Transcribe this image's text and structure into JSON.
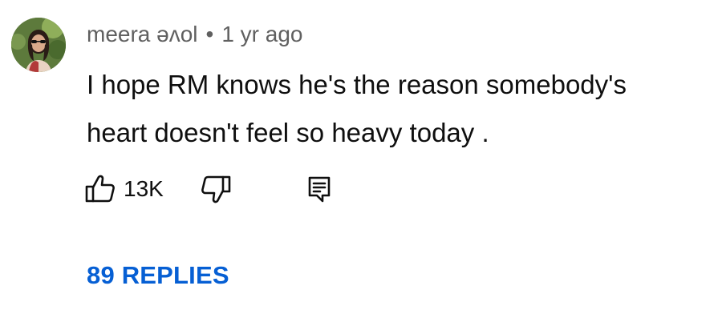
{
  "comment": {
    "author": "meera əʌol",
    "separator": "•",
    "timestamp": "1 yr ago",
    "text_lines": [
      "I hope RM knows he's the reason somebody's",
      "heart doesn't feel so heavy today ."
    ],
    "like_count": "13K",
    "replies_label": "89 REPLIES"
  },
  "icons": {
    "like": "thumbs-up-icon",
    "dislike": "thumbs-down-icon",
    "reply": "reply-comment-icon"
  },
  "colors": {
    "text": "#0f0f0f",
    "meta": "#606060",
    "link": "#065fd4"
  }
}
